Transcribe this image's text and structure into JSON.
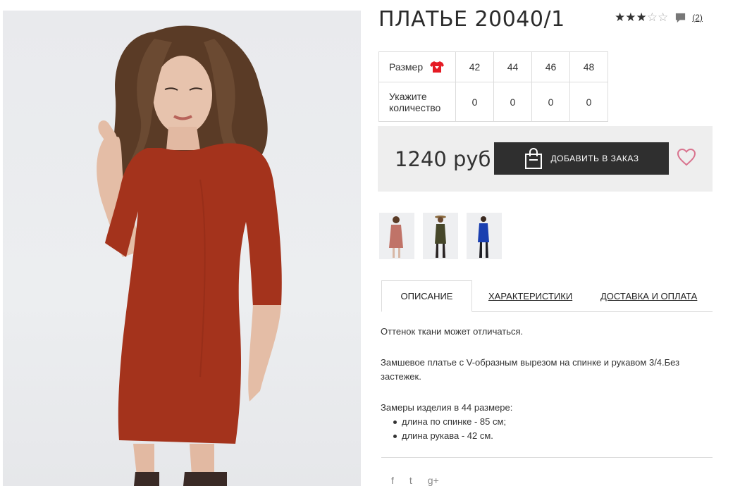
{
  "product": {
    "title": "ПЛАТЬЕ 20040/1",
    "rating": 3,
    "rating_max": 5,
    "review_count": "(2)"
  },
  "sizes": {
    "size_label": "Размер",
    "qty_label_1": "Укажите",
    "qty_label_2": "количество",
    "options": [
      "42",
      "44",
      "46",
      "48"
    ],
    "quantities": [
      "0",
      "0",
      "0",
      "0"
    ]
  },
  "buy": {
    "price": "1240 руб",
    "add_label": "ДОБАВИТЬ В ЗАКАЗ"
  },
  "tabs": {
    "description": "ОПИСАНИЕ",
    "specs": "ХАРАКТЕРИСТИКИ",
    "delivery": "ДОСТАВКА И ОПЛАТА"
  },
  "description": {
    "p1": "Оттенок ткани может отличаться.",
    "p2": "Замшевое платье с V-образным вырезом на спинке и рукавом 3/4.Без застежек.",
    "p3": "Замеры изделия в 44 размере:",
    "bullets": [
      "длина по спинке - 85 см;",
      "длина рукава - 42 см."
    ]
  },
  "social": {
    "facebook": "f",
    "twitter": "t",
    "google": "g+"
  },
  "colors": {
    "accent_heart": "#d9738e",
    "button": "#2f2f2f",
    "dress_red": "#a4331c",
    "size_icon_red": "#e51b24"
  }
}
